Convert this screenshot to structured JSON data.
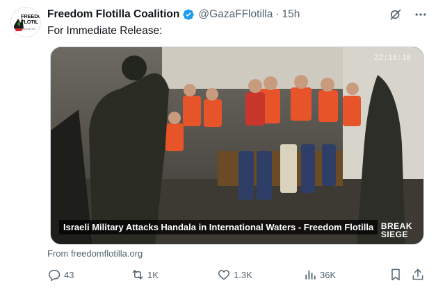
{
  "author": {
    "display_name": "Freedom Flotilla Coalition",
    "handle": "@GazaFFlotilla",
    "separator": "·",
    "time": "15h",
    "avatar_text_line1": "FREEDO",
    "avatar_text_line2": "FLOTIL",
    "avatar_text_sub": "COALITIO"
  },
  "tweet": {
    "text": "For Immediate Release:"
  },
  "media": {
    "caption": "Israeli Military Attacks Handala in International Waters - Freedom Flotilla",
    "timestamp_overlay": "22:18:18",
    "brand_line1": "BREAK",
    "brand_line2": "SIEGE"
  },
  "card": {
    "source": "From freedomflotilla.org"
  },
  "metrics": {
    "replies": "43",
    "reposts": "1K",
    "likes": "1.3K",
    "views": "36K"
  },
  "icons": {
    "verified": "verified-badge-icon",
    "grok": "grok-icon",
    "more": "more-icon",
    "reply": "reply-icon",
    "repost": "repost-icon",
    "like": "like-icon",
    "views": "views-icon",
    "bookmark": "bookmark-icon",
    "share": "share-icon"
  },
  "colors": {
    "accent": "#1d9bf0",
    "muted": "#536471",
    "text": "#0f1419"
  }
}
